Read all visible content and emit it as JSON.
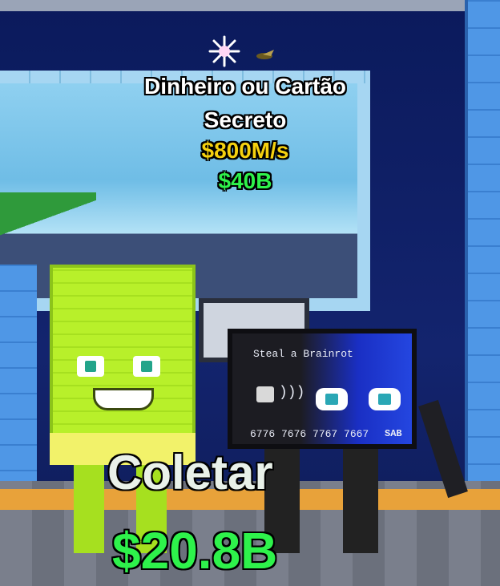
{
  "overhead": {
    "name_line1": "Dinheiro ou Cartão",
    "name_line2": "Secreto",
    "income_rate": "$800M/s",
    "price": "$40B"
  },
  "card": {
    "brand": "Steal a Brainrot",
    "number": "6776 7676 7767 7667",
    "logo": "SAB"
  },
  "prompt": {
    "collect_label": "Coletar",
    "amount": "$20.8B"
  },
  "colors": {
    "yellow": "#f5d10f",
    "green": "#2ef24b",
    "white": "#ffffff"
  },
  "icons": [
    "sparkle-icon",
    "bug-icon"
  ]
}
